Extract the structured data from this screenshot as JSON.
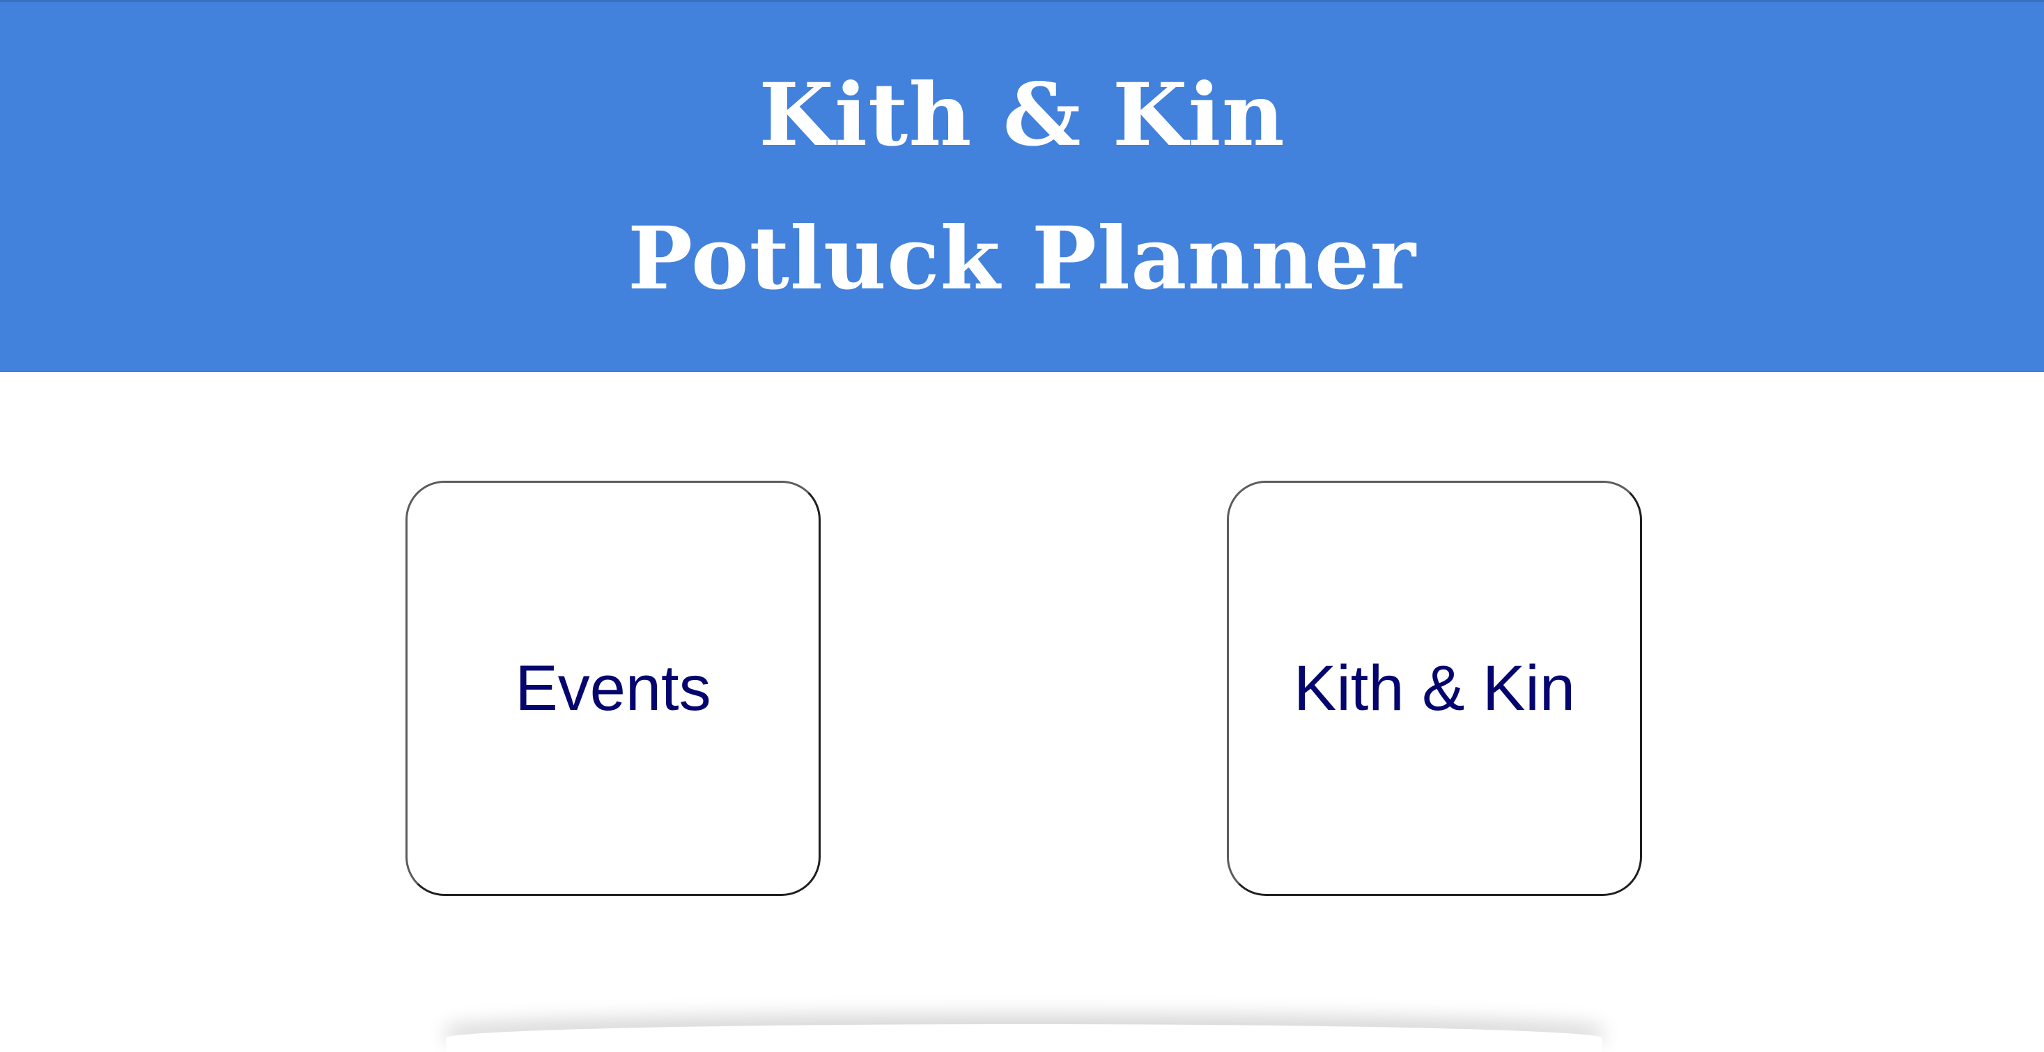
{
  "header": {
    "title_line1": "Kith & Kin",
    "title_line2": "Potluck Planner"
  },
  "nav": {
    "tiles": [
      {
        "label": "Events"
      },
      {
        "label": "Kith & Kin"
      }
    ]
  },
  "colors": {
    "header_background": "#4281dc",
    "title_text": "#ffffff",
    "tile_text": "#050570",
    "page_background": "#ffffff"
  }
}
